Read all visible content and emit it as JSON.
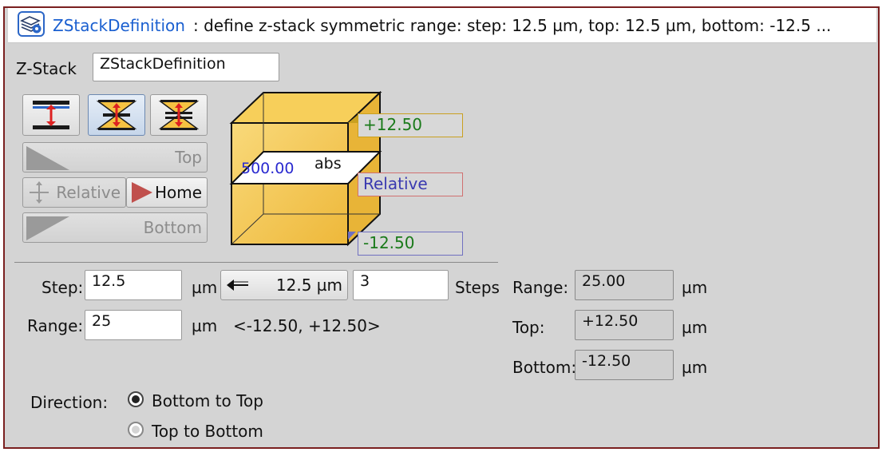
{
  "header": {
    "name": "ZStackDefinition",
    "description": ": define z-stack symmetric range: step: 12.5 µm, top: 12.5 µm, bottom: -12.5 ..."
  },
  "zstack": {
    "label": "Z-Stack",
    "name_value": "ZStackDefinition"
  },
  "position_buttons": {
    "top": "Top",
    "relative": "Relative",
    "home": "Home",
    "bottom": "Bottom"
  },
  "cube": {
    "center_value": "500.00",
    "center_mode": "abs",
    "top_label": "+12.50",
    "relative_label": "Relative",
    "bottom_label": "-12.50"
  },
  "step": {
    "label": "Step:",
    "value": "12.5",
    "unit": "µm",
    "transfer_button": "12.5 µm",
    "steps_value": "3",
    "steps_label": "Steps"
  },
  "range": {
    "label": "Range:",
    "value": "25",
    "unit": "µm",
    "interval": "<-12.50, +12.50>"
  },
  "summary": {
    "range_label": "Range:",
    "range_value": "25.00",
    "top_label": "Top:",
    "top_value": "+12.50",
    "bottom_label": "Bottom:",
    "bottom_value": "-12.50",
    "unit": "µm"
  },
  "direction": {
    "label": "Direction:",
    "options": [
      "Bottom to Top",
      "Top to Bottom"
    ],
    "selected": "Bottom to Top"
  },
  "icons": [
    "zstack-settings-icon",
    "center-range-icon",
    "symmetric-range-icon",
    "top-bottom-range-icon",
    "move-icon",
    "arrow-left-icon"
  ],
  "colors": {
    "title_blue": "#1a5fd0",
    "cube_fill": "#f5c242",
    "top_green": "#1a7a1a",
    "relative_blue": "#3a3ab0",
    "frame_border": "#7a1f1f"
  }
}
